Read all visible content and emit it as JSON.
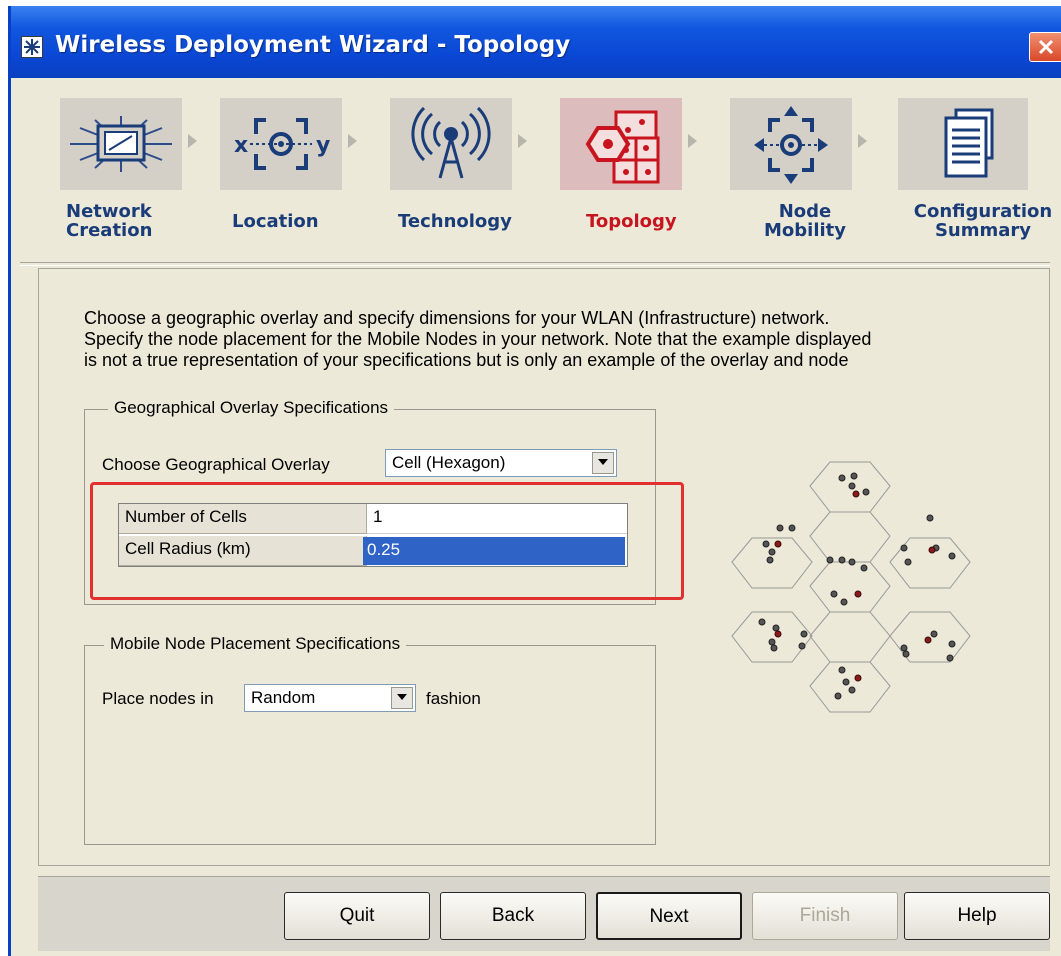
{
  "window": {
    "title": "Wireless Deployment Wizard - Topology"
  },
  "steps": [
    {
      "label_line1": "Network",
      "label_line2": "Creation",
      "icon": "network-creation-icon"
    },
    {
      "label_line1": "Location",
      "label_line2": "",
      "icon": "location-icon"
    },
    {
      "label_line1": "Technology",
      "label_line2": "",
      "icon": "technology-antenna-icon"
    },
    {
      "label_line1": "Topology",
      "label_line2": "",
      "icon": "topology-icon",
      "active": true
    },
    {
      "label_line1": "Node",
      "label_line2": "Mobility",
      "icon": "node-mobility-icon"
    },
    {
      "label_line1": "Configuration",
      "label_line2": "Summary",
      "icon": "configuration-summary-icon"
    }
  ],
  "description": {
    "line1": "Choose a geographic overlay and specify dimensions for your WLAN (Infrastructure) network.",
    "line2": "Specify the node placement for the Mobile Nodes in your network. Note that the example displayed",
    "line3": "is not a true representation of your specifications but is only an example of the overlay and node"
  },
  "geo_group": {
    "legend": "Geographical Overlay Specifications",
    "overlay_label": "Choose Geographical Overlay",
    "overlay_value": "Cell (Hexagon)",
    "rows": [
      {
        "name": "Number of Cells",
        "value": "1"
      },
      {
        "name": "Cell Radius (km)",
        "value": "0.25"
      }
    ]
  },
  "placement_group": {
    "legend": "Mobile Node Placement Specifications",
    "prefix": "Place nodes in",
    "value": "Random",
    "suffix": "fashion"
  },
  "buttons": {
    "quit": "Quit",
    "back": "Back",
    "next": "Next",
    "finish": "Finish",
    "help": "Help"
  },
  "colors": {
    "title_bar": "#0a47d4",
    "active_step": "#c8141e",
    "step_label": "#1a3c78",
    "highlight": "#e23030",
    "selection": "#2f63c6",
    "node_gray": "#555555",
    "node_red": "#8b1a1a"
  }
}
